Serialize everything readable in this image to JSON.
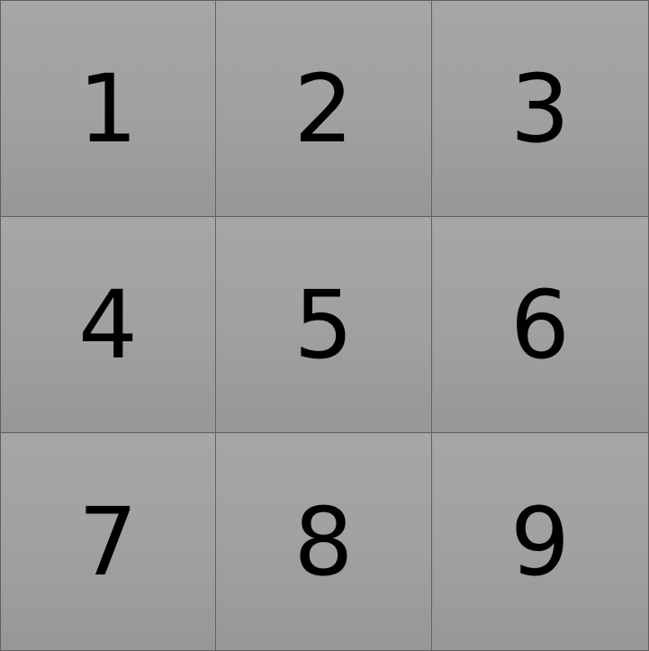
{
  "tiles": [
    {
      "label": "1"
    },
    {
      "label": "2"
    },
    {
      "label": "3"
    },
    {
      "label": "4"
    },
    {
      "label": "5"
    },
    {
      "label": "6"
    },
    {
      "label": "7"
    },
    {
      "label": "8"
    },
    {
      "label": "9"
    }
  ],
  "colors": {
    "tile_top": "#a6a6a6",
    "tile_bottom": "#979797",
    "grid_line": "#5f5f5f",
    "number": "#000000"
  }
}
